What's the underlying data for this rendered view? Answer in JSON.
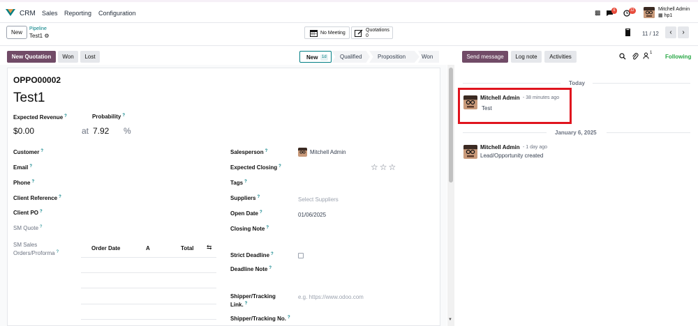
{
  "navbar": {
    "app_name": "CRM",
    "menus": [
      "Sales",
      "Reporting",
      "Configuration"
    ],
    "messages_count": "6",
    "activities_count": "12",
    "user_name": "Mitchell Admin",
    "company": "hp1"
  },
  "control_panel": {
    "new_label": "New",
    "breadcrumb": "Pipeline",
    "record_name": "Test1",
    "meeting_label": "No Meeting",
    "quotations_label": "Quotations",
    "quotations_count": "0",
    "pager": "11 / 12"
  },
  "statusbar": {
    "new_quotation": "New Quotation",
    "won": "Won",
    "lost": "Lost",
    "stages": [
      "New",
      "Qualified",
      "Proposition",
      "Won"
    ],
    "active_stage_duration": "1d"
  },
  "form": {
    "reference": "OPPO00002",
    "title": "Test1",
    "expected_revenue_label": "Expected Revenue",
    "expected_revenue": "$0.00",
    "probability_label": "Probability",
    "probability_at": "at",
    "probability": "7.92",
    "percent": "%",
    "left": {
      "customer": "Customer",
      "email": "Email",
      "phone": "Phone",
      "client_reference": "Client Reference",
      "client_po": "Client PO",
      "sm_quote": "SM Quote",
      "sm_sales_1": "SM Sales",
      "sm_sales_2": "Orders/Proforma"
    },
    "orders_table": {
      "headers": [
        "Order Date",
        "A",
        "Total"
      ]
    },
    "right": {
      "salesperson": "Salesperson",
      "salesperson_value": "Mitchell Admin",
      "expected_closing": "Expected Closing",
      "tags": "Tags",
      "suppliers": "Suppliers",
      "suppliers_placeholder": "Select Suppliers",
      "open_date": "Open Date",
      "open_date_value": "01/06/2025",
      "closing_note": "Closing Note",
      "strict_deadline": "Strict Deadline",
      "deadline_note": "Deadline Note",
      "shipper_link_1": "Shipper/Tracking",
      "shipper_link_2": "Link.",
      "shipper_link_placeholder": "e.g. https://www.odoo.com",
      "shipper_no": "Shipper/Tracking No."
    },
    "tooltip_mark": "?"
  },
  "chatter": {
    "send_message": "Send message",
    "log_note": "Log note",
    "activities": "Activities",
    "followers_count": "1",
    "following": "Following",
    "today": "Today",
    "date_sep": "January 6, 2025",
    "messages": [
      {
        "author": "Mitchell Admin",
        "time": "- 38 minutes ago",
        "body": "Test"
      },
      {
        "author": "Mitchell Admin",
        "time": "- 1 day ago",
        "body": "Lead/Opportunity created"
      }
    ]
  },
  "colors": {
    "primary": "#714b67",
    "link": "#017e84",
    "highlight": "#e0141e",
    "badge": "#e74c3c"
  }
}
